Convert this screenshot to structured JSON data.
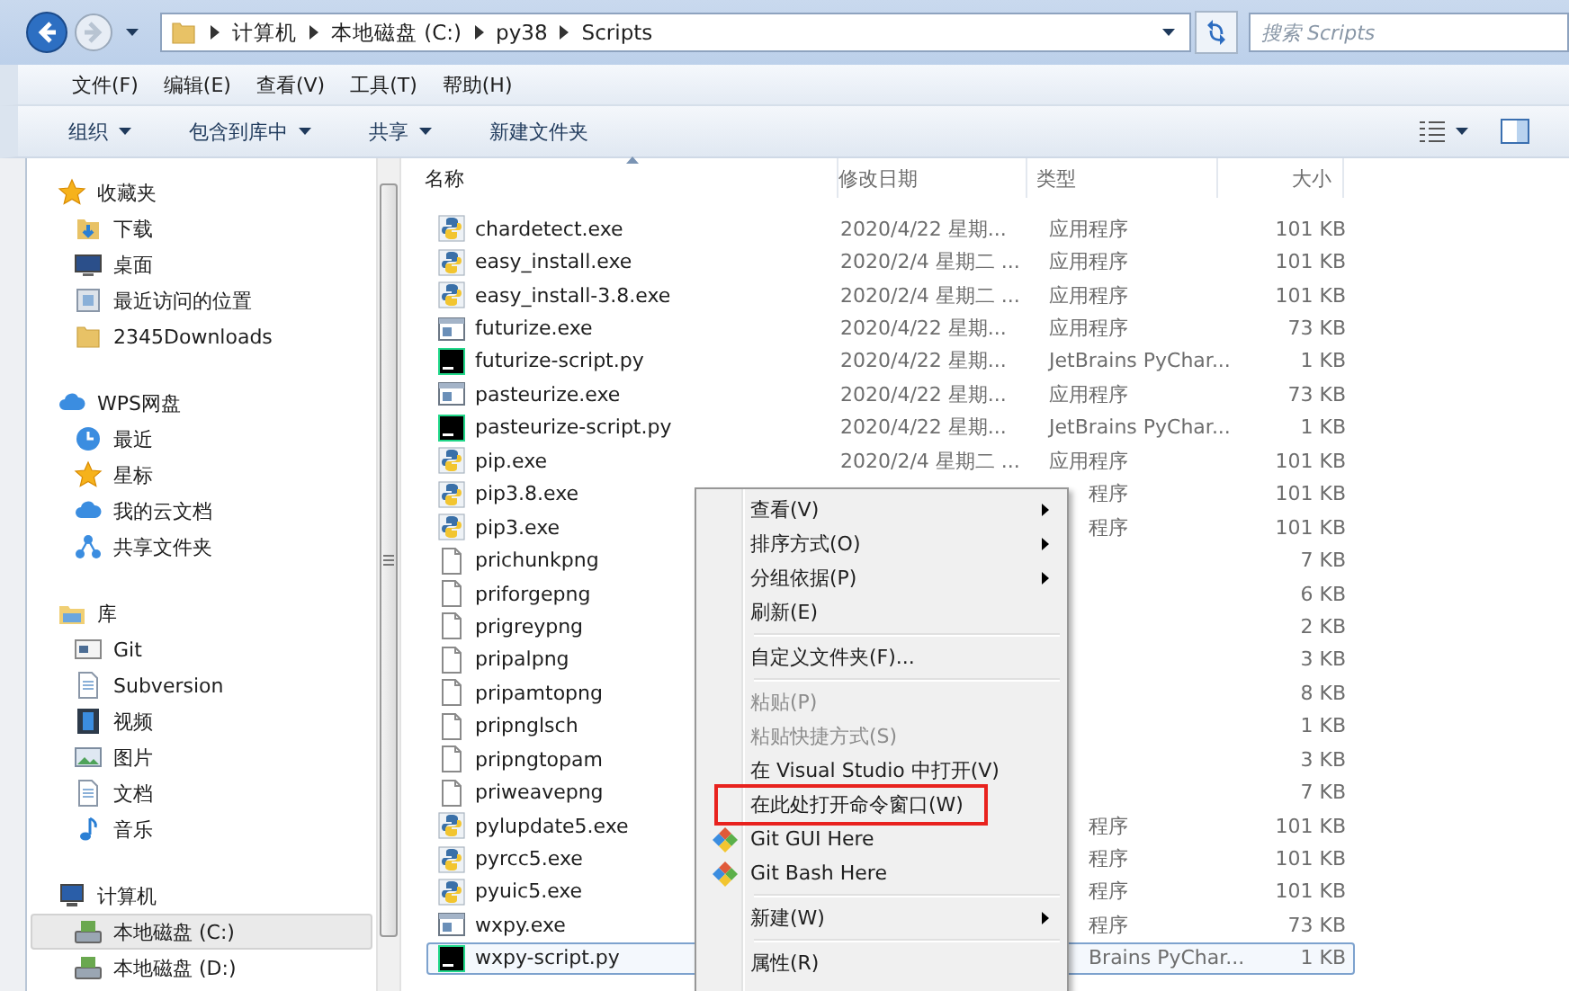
{
  "nav": {
    "breadcrumb": [
      "计算机",
      "本地磁盘 (C:)",
      "py38",
      "Scripts"
    ],
    "search": {
      "placeholder": "搜索 Scripts"
    }
  },
  "menubar": [
    "文件(F)",
    "编辑(E)",
    "查看(V)",
    "工具(T)",
    "帮助(H)"
  ],
  "toolbar": [
    {
      "label": "组织",
      "dropdown": true
    },
    {
      "label": "包含到库中",
      "dropdown": true
    },
    {
      "label": "共享",
      "dropdown": true
    },
    {
      "label": "新建文件夹",
      "dropdown": false
    }
  ],
  "sidebar": {
    "sections": [
      {
        "label": "收藏夹",
        "kind": "star",
        "selected": false,
        "children": [
          {
            "label": "下载",
            "kind": "download",
            "selected": false
          },
          {
            "label": "桌面",
            "kind": "desktop",
            "selected": false
          },
          {
            "label": "最近访问的位置",
            "kind": "recent",
            "selected": false
          },
          {
            "label": "2345Downloads",
            "kind": "folder",
            "selected": false
          }
        ]
      },
      {
        "label": "WPS网盘",
        "kind": "cloud",
        "selected": false,
        "children": [
          {
            "label": "最近",
            "kind": "clock",
            "selected": false
          },
          {
            "label": "星标",
            "kind": "star",
            "selected": false
          },
          {
            "label": "我的云文档",
            "kind": "cloud",
            "selected": false
          },
          {
            "label": "共享文件夹",
            "kind": "share",
            "selected": false
          }
        ]
      },
      {
        "label": "库",
        "kind": "library",
        "selected": false,
        "children": [
          {
            "label": "Git",
            "kind": "gitlib",
            "selected": false
          },
          {
            "label": "Subversion",
            "kind": "document",
            "selected": false
          },
          {
            "label": "视频",
            "kind": "video",
            "selected": false
          },
          {
            "label": "图片",
            "kind": "picture",
            "selected": false
          },
          {
            "label": "文档",
            "kind": "document",
            "selected": false
          },
          {
            "label": "音乐",
            "kind": "music",
            "selected": false
          }
        ]
      },
      {
        "label": "计算机",
        "kind": "computer",
        "selected": false,
        "children": [
          {
            "label": "本地磁盘 (C:)",
            "kind": "drive",
            "selected": true
          },
          {
            "label": "本地磁盘 (D:)",
            "kind": "drive",
            "selected": false
          }
        ]
      }
    ]
  },
  "table": {
    "columns": [
      {
        "label": "名称",
        "sorted": true
      },
      {
        "label": "修改日期",
        "sorted": false
      },
      {
        "label": "类型",
        "sorted": false
      },
      {
        "label": "大小",
        "sorted": false
      }
    ],
    "rows": [
      {
        "name": "chardetect.exe",
        "date": "2020/4/22 星期...",
        "type": "应用程序",
        "size": "101 KB",
        "kind": "python",
        "selected": false
      },
      {
        "name": "easy_install.exe",
        "date": "2020/2/4 星期二 ...",
        "type": "应用程序",
        "size": "101 KB",
        "kind": "python",
        "selected": false
      },
      {
        "name": "easy_install-3.8.exe",
        "date": "2020/2/4 星期二 ...",
        "type": "应用程序",
        "size": "101 KB",
        "kind": "python",
        "selected": false
      },
      {
        "name": "futurize.exe",
        "date": "2020/4/22 星期...",
        "type": "应用程序",
        "size": "73 KB",
        "kind": "exe",
        "selected": false
      },
      {
        "name": "futurize-script.py",
        "date": "2020/4/22 星期...",
        "type": "JetBrains PyChar...",
        "size": "1 KB",
        "kind": "pycharm",
        "selected": false
      },
      {
        "name": "pasteurize.exe",
        "date": "2020/4/22 星期...",
        "type": "应用程序",
        "size": "73 KB",
        "kind": "exe",
        "selected": false
      },
      {
        "name": "pasteurize-script.py",
        "date": "2020/4/22 星期...",
        "type": "JetBrains PyChar...",
        "size": "1 KB",
        "kind": "pycharm",
        "selected": false
      },
      {
        "name": "pip.exe",
        "date": "2020/2/4 星期二 ...",
        "type": "应用程序",
        "size": "101 KB",
        "kind": "python",
        "selected": false
      },
      {
        "name": "pip3.8.exe",
        "type": "程序",
        "size": "101 KB",
        "kind": "python",
        "selected": false
      },
      {
        "name": "pip3.exe",
        "type": "程序",
        "size": "101 KB",
        "kind": "python",
        "selected": false
      },
      {
        "name": "prichunkpng",
        "size": "7 KB",
        "kind": "file",
        "selected": false
      },
      {
        "name": "priforgepng",
        "size": "6 KB",
        "kind": "file",
        "selected": false
      },
      {
        "name": "prigreypng",
        "size": "2 KB",
        "kind": "file",
        "selected": false
      },
      {
        "name": "pripalpng",
        "size": "3 KB",
        "kind": "file",
        "selected": false
      },
      {
        "name": "pripamtopng",
        "size": "8 KB",
        "kind": "file",
        "selected": false
      },
      {
        "name": "pripnglsch",
        "size": "1 KB",
        "kind": "file",
        "selected": false
      },
      {
        "name": "pripngtopam",
        "size": "3 KB",
        "kind": "file",
        "selected": false
      },
      {
        "name": "priweavepng",
        "size": "7 KB",
        "kind": "file",
        "selected": false
      },
      {
        "name": "pylupdate5.exe",
        "type": "程序",
        "size": "101 KB",
        "kind": "python",
        "selected": false
      },
      {
        "name": "pyrcc5.exe",
        "type": "程序",
        "size": "101 KB",
        "kind": "python",
        "selected": false
      },
      {
        "name": "pyuic5.exe",
        "type": "程序",
        "size": "101 KB",
        "kind": "python",
        "selected": false
      },
      {
        "name": "wxpy.exe",
        "type": "程序",
        "size": "73 KB",
        "kind": "exe",
        "selected": false
      },
      {
        "name": "wxpy-script.py",
        "type": "Brains PyChar...",
        "size": "1 KB",
        "kind": "pycharm",
        "selected": true
      }
    ]
  },
  "context_menu": {
    "items": [
      {
        "kind": "submenu",
        "label": "查看(V)",
        "disabled": false,
        "highlighted": false
      },
      {
        "kind": "submenu",
        "label": "排序方式(O)",
        "disabled": false,
        "highlighted": false
      },
      {
        "kind": "submenu",
        "label": "分组依据(P)",
        "disabled": false,
        "highlighted": false
      },
      {
        "kind": "command",
        "label": "刷新(E)",
        "disabled": false,
        "highlighted": false
      },
      {
        "kind": "separator"
      },
      {
        "kind": "command",
        "label": "自定义文件夹(F)...",
        "disabled": false,
        "highlighted": false
      },
      {
        "kind": "separator"
      },
      {
        "kind": "command",
        "label": "粘贴(P)",
        "disabled": true,
        "highlighted": false
      },
      {
        "kind": "command",
        "label": "粘贴快捷方式(S)",
        "disabled": true,
        "highlighted": false
      },
      {
        "kind": "command",
        "label": "在 Visual Studio 中打开(V)",
        "disabled": false,
        "highlighted": false
      },
      {
        "kind": "command",
        "label": "在此处打开命令窗口(W)",
        "disabled": false,
        "highlighted": true
      },
      {
        "kind": "git",
        "label": "Git GUI Here",
        "disabled": false,
        "highlighted": false
      },
      {
        "kind": "git",
        "label": "Git Bash Here",
        "disabled": false,
        "highlighted": false
      },
      {
        "kind": "separator"
      },
      {
        "kind": "submenu",
        "label": "新建(W)",
        "disabled": false,
        "highlighted": false
      },
      {
        "kind": "separator"
      },
      {
        "kind": "command",
        "label": "属性(R)",
        "disabled": false,
        "highlighted": false
      }
    ]
  }
}
